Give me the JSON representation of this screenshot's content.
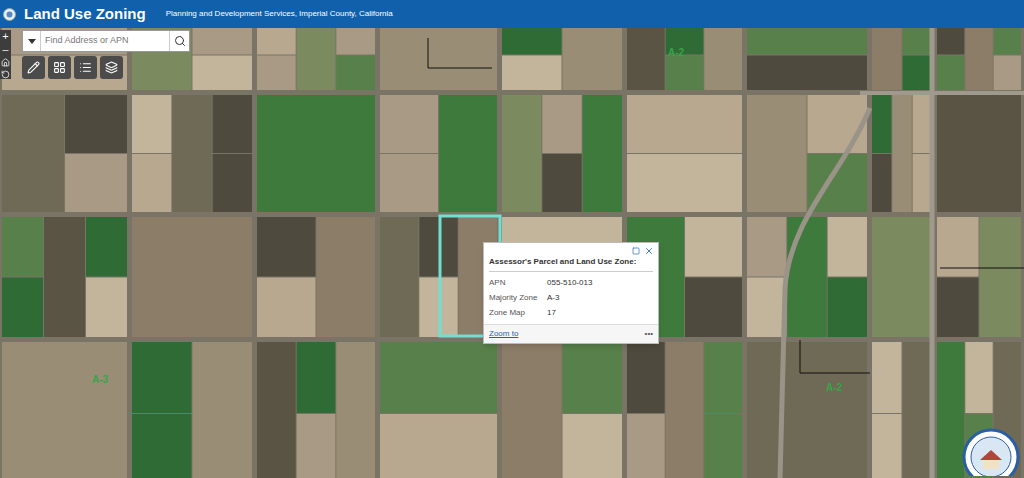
{
  "header": {
    "title": "Land Use Zoning",
    "subtitle": "Planning and Development Services, Imperial County, California"
  },
  "search": {
    "placeholder": "Find Address or APN"
  },
  "zoom": {
    "in": "+"
  },
  "map_labels": [
    {
      "text": "A-2"
    },
    {
      "text": "A-3"
    },
    {
      "text": "A-2"
    }
  ],
  "popup": {
    "title": "Assessor's Parcel and Land Use Zone:",
    "fields": [
      {
        "label": "APN",
        "value": "055-510-013"
      },
      {
        "label": "Majority Zone",
        "value": "A-3"
      },
      {
        "label": "Zone Map",
        "value": "17"
      }
    ],
    "zoom_link": "Zoom to",
    "more": "•••"
  }
}
